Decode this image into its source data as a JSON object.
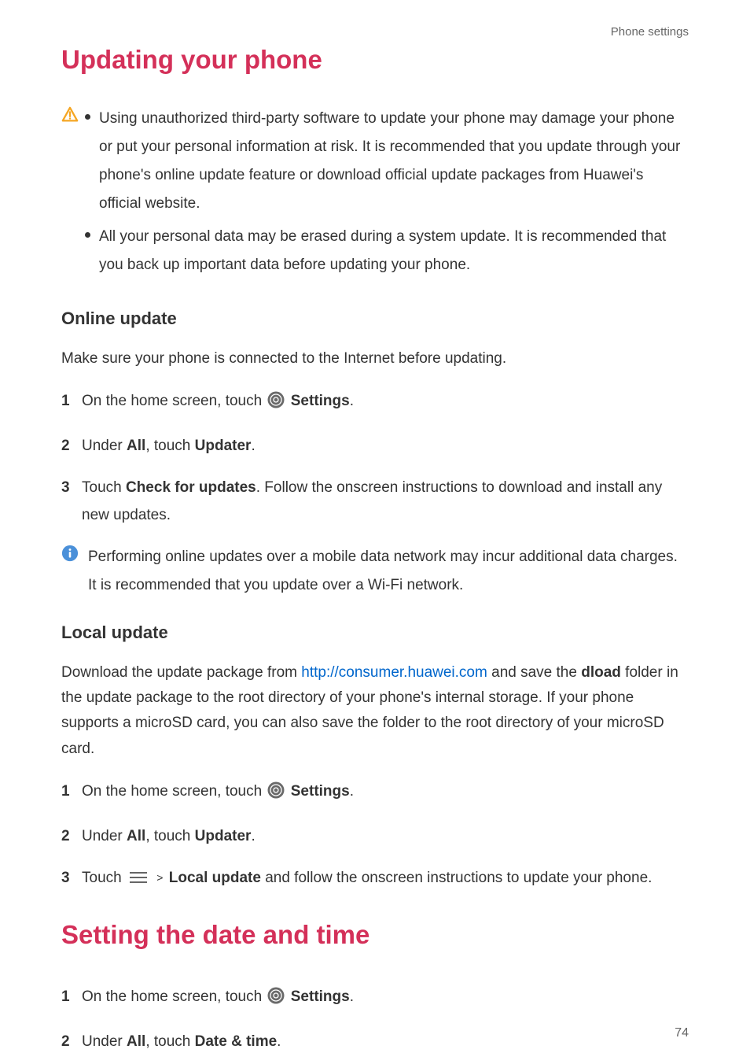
{
  "header": {
    "crumb": "Phone settings"
  },
  "section1": {
    "title": "Updating your phone",
    "warnings": [
      "Using unauthorized third-party software to update your phone may damage your phone or put your personal information at risk. It is recommended that you update through your phone's online update feature or download official update packages from Huawei's official website.",
      "All your personal data may be erased during a system update. It is recommended that you back up important data before updating your phone."
    ],
    "online": {
      "heading": "Online  update",
      "intro": "Make sure your phone is connected to the Internet before updating.",
      "steps": {
        "s1_pre": "On the home screen, touch ",
        "s1_bold": "Settings",
        "s2_pre": "Under ",
        "s2_b1": "All",
        "s2_mid": ", touch ",
        "s2_b2": "Updater",
        "s3_pre": "Touch ",
        "s3_b1": "Check for updates",
        "s3_post": ". Follow the onscreen instructions to download and install any new updates."
      },
      "info": "Performing online updates over a mobile data network may incur additional data charges. It is recommended that you update over a Wi-Fi network."
    },
    "local": {
      "heading": "Local  update",
      "p1_a": "Download the update package from ",
      "p1_link": "http://consumer.huawei.com",
      "p1_b": " and save the ",
      "p1_bold": "dload",
      "p1_c": " folder in the update package to the root directory of your phone's internal storage. If your phone supports a microSD card, you can also save the folder to the root directory of your microSD card.",
      "steps": {
        "s1_pre": "On the home screen, touch ",
        "s1_bold": "Settings",
        "s2_pre": "Under ",
        "s2_b1": "All",
        "s2_mid": ", touch ",
        "s2_b2": "Updater",
        "s3_pre": "Touch ",
        "s3_bold": "Local update",
        "s3_post": " and follow the onscreen instructions to update your phone."
      }
    }
  },
  "section2": {
    "title": "Setting the date and time",
    "steps": {
      "s1_pre": "On the home screen, touch ",
      "s1_bold": "Settings",
      "s2_pre": "Under ",
      "s2_b1": "All",
      "s2_mid": ", touch ",
      "s2_b2": "Date & time"
    }
  },
  "pagenum": "74",
  "common": {
    "period": ".",
    "gt": ">"
  }
}
